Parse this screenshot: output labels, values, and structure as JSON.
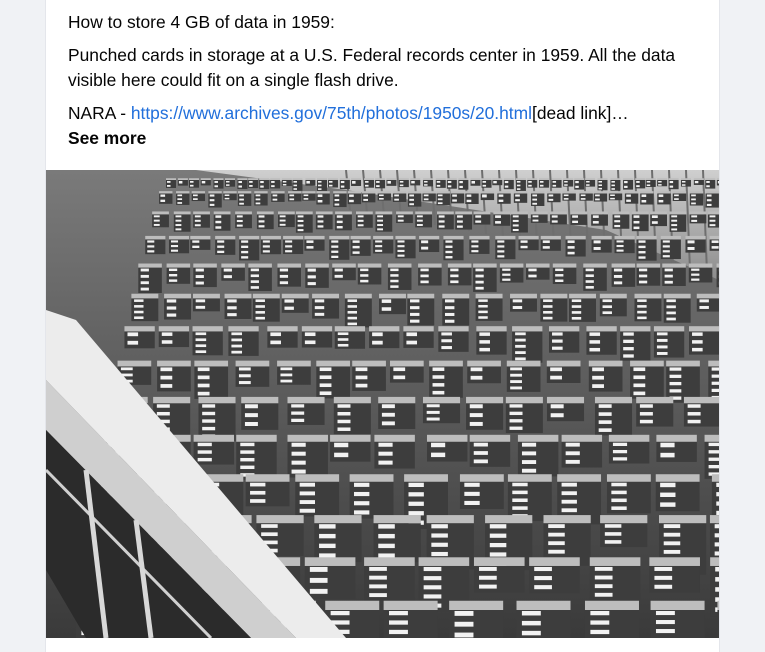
{
  "post": {
    "title_line": "How to store 4 GB of data in 1959:",
    "caption": "Punched cards in storage at a U.S. Federal records center in 1959. All the data visible here could fit on a single flash drive.",
    "source_prefix": "NARA - ",
    "source_url": "https://www.archives.gov/75th/photos/1950s/20.html",
    "source_suffix": "[dead link]…",
    "see_more_label": "See more"
  },
  "photo": {
    "subject": "warehouse of punched card boxes",
    "colors": {
      "sky": "#d9d9d9",
      "floor": "#5c5c5c",
      "box_top": "#bdbdbd",
      "box_side": "#3d3d3d",
      "label": "#f2f2f2",
      "railing": "#e6e6e6"
    }
  }
}
